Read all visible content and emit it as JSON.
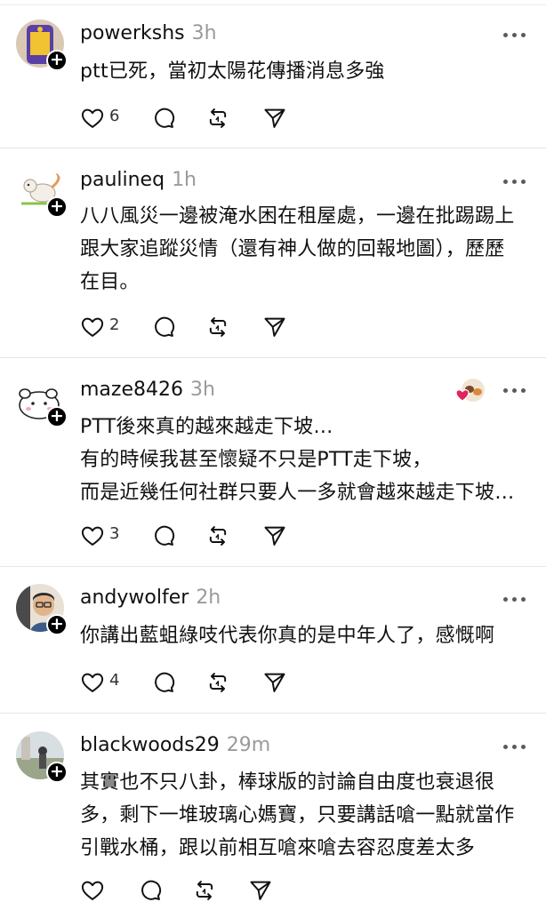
{
  "comments": [
    {
      "username": "powerkshs",
      "time": "3h",
      "text": "ptt已死，當初太陽花傳播消息多強",
      "likes": "6"
    },
    {
      "username": "paulineq",
      "time": "1h",
      "text": "八八風災一邊被淹水困在租屋處，一邊在批踢踢上\n跟大家追蹤災情（還有神人做的回報地圖），歷歷\n在目。",
      "likes": "2"
    },
    {
      "username": "maze8426",
      "time": "3h",
      "text": "PTT後來真的越來越走下坡…\n有的時候我甚至懷疑不只是PTT走下坡，\n而是近幾任何社群只要人一多就會越來越走下坡…",
      "likes": "3"
    },
    {
      "username": "andywolfer",
      "time": "2h",
      "text": "你講出藍蛆綠吱代表你真的是中年人了，感慨啊",
      "likes": "4"
    },
    {
      "username": "blackwoods29",
      "time": "29m",
      "text": "其實也不只八卦，棒球版的討論自由度也衰退很\n多，剩下一堆玻璃心媽寶，只要講話嗆一點就當作\n引戰水桶，跟以前相互嗆來嗆去容忍度差太多",
      "likes": ""
    }
  ],
  "icons": {
    "follow": "plus-icon",
    "more": "more-icon",
    "like": "heart-icon",
    "reply": "comment-icon",
    "repost": "repost-icon",
    "share": "send-icon"
  },
  "colors": {
    "text": "#111111",
    "meta": "#9a9a9a",
    "divider": "#e6e6e6",
    "reacted_heart": "#e0245e"
  }
}
